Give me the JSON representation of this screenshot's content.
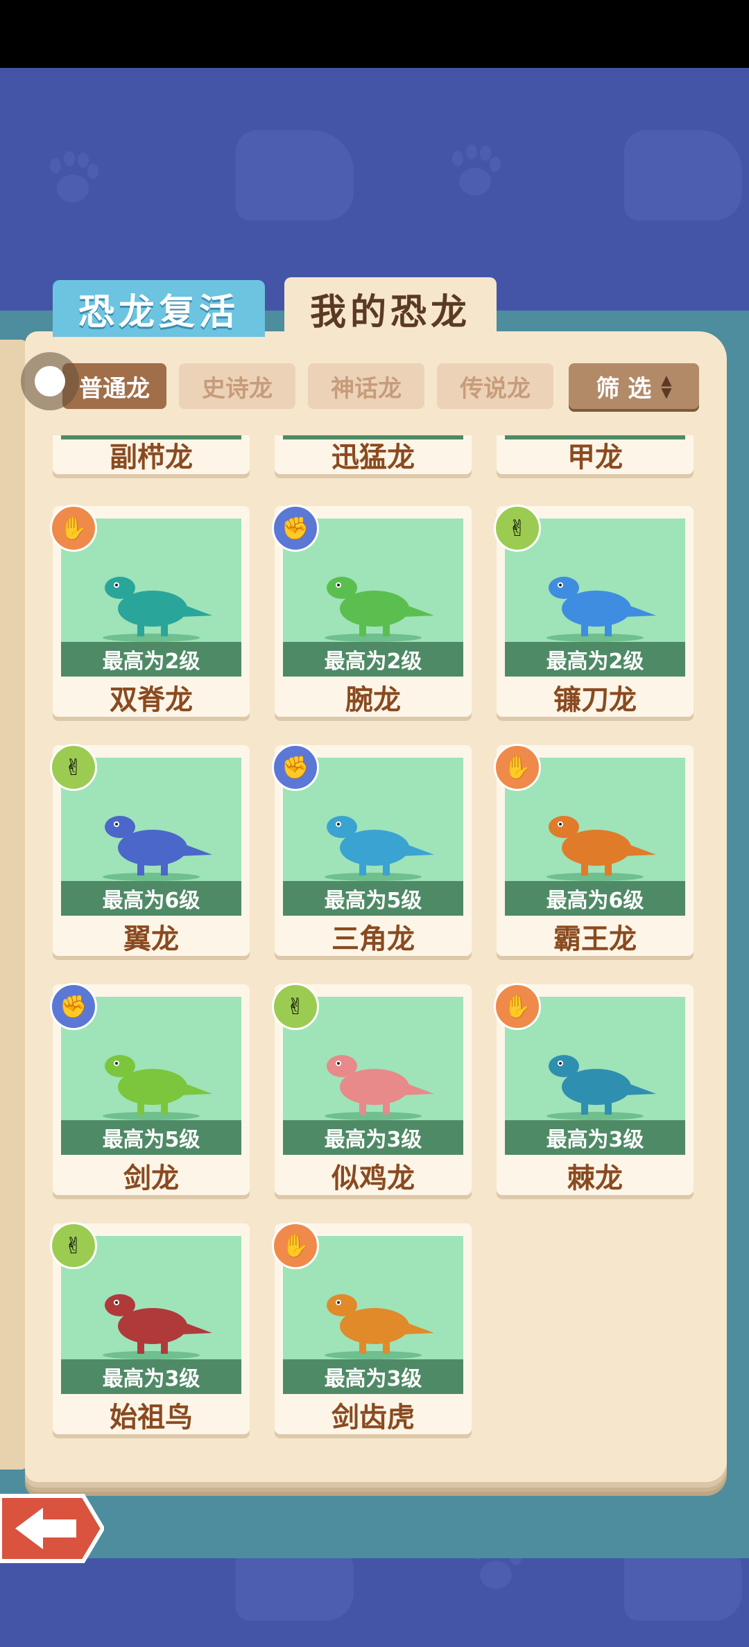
{
  "tabs": {
    "revive": "恐龙复活",
    "my_dinos": "我的恐龙"
  },
  "filters": {
    "common": "普通龙",
    "epic": "史诗龙",
    "myth": "神话龙",
    "legend": "传说龙",
    "filter_button": "筛 选"
  },
  "top_row": [
    "副栉龙",
    "迅猛龙",
    "甲龙"
  ],
  "cards": [
    {
      "name": "双脊龙",
      "level": "最高为2级",
      "badge": "orange",
      "dino_color": "#2aa59a"
    },
    {
      "name": "腕龙",
      "level": "最高为2级",
      "badge": "blue",
      "dino_color": "#5bbf4f"
    },
    {
      "name": "镰刀龙",
      "level": "最高为2级",
      "badge": "green",
      "dino_color": "#3f8de0"
    },
    {
      "name": "翼龙",
      "level": "最高为6级",
      "badge": "green",
      "dino_color": "#4a67c9"
    },
    {
      "name": "三角龙",
      "level": "最高为5级",
      "badge": "blue",
      "dino_color": "#3aa3d1"
    },
    {
      "name": "霸王龙",
      "level": "最高为6级",
      "badge": "orange",
      "dino_color": "#e07b2a"
    },
    {
      "name": "剑龙",
      "level": "最高为5级",
      "badge": "blue",
      "dino_color": "#7cc63d"
    },
    {
      "name": "似鸡龙",
      "level": "最高为3级",
      "badge": "green",
      "dino_color": "#e88a8a"
    },
    {
      "name": "棘龙",
      "level": "最高为3级",
      "badge": "orange",
      "dino_color": "#2f8fb0"
    },
    {
      "name": "始祖鸟",
      "level": "最高为3级",
      "badge": "green",
      "dino_color": "#b03a3a"
    },
    {
      "name": "剑齿虎",
      "level": "最高为3级",
      "badge": "orange",
      "dino_color": "#e08a2a"
    }
  ]
}
